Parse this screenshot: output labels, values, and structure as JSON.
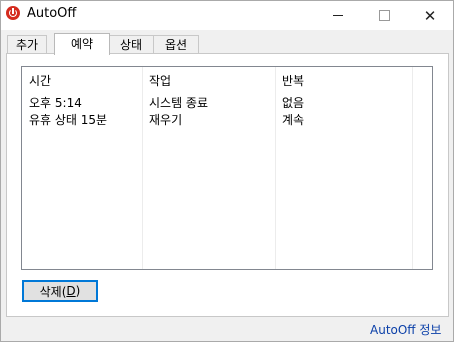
{
  "window": {
    "title": "AutoOff"
  },
  "window_controls": {
    "minimize": "minimize",
    "maximize": "maximize",
    "close": "✕"
  },
  "tabs": [
    {
      "label": "추가"
    },
    {
      "label": "예약",
      "active": true
    },
    {
      "label": "상태"
    },
    {
      "label": "옵션"
    }
  ],
  "schedule_list": {
    "columns": [
      "시간",
      "작업",
      "반복"
    ],
    "rows": [
      [
        "오후 5:14",
        "시스템 종료",
        "없음"
      ],
      [
        "유휴 상태 15분",
        "재우기",
        "계속"
      ]
    ]
  },
  "buttons": {
    "delete_prefix": "삭제(",
    "delete_mnemonic": "D",
    "delete_suffix": ")"
  },
  "footer": {
    "about_link": "AutoOff 정보"
  },
  "colors": {
    "accent": "#0078d7",
    "app_icon": "#d52b1e",
    "link": "#0a3fa8"
  }
}
